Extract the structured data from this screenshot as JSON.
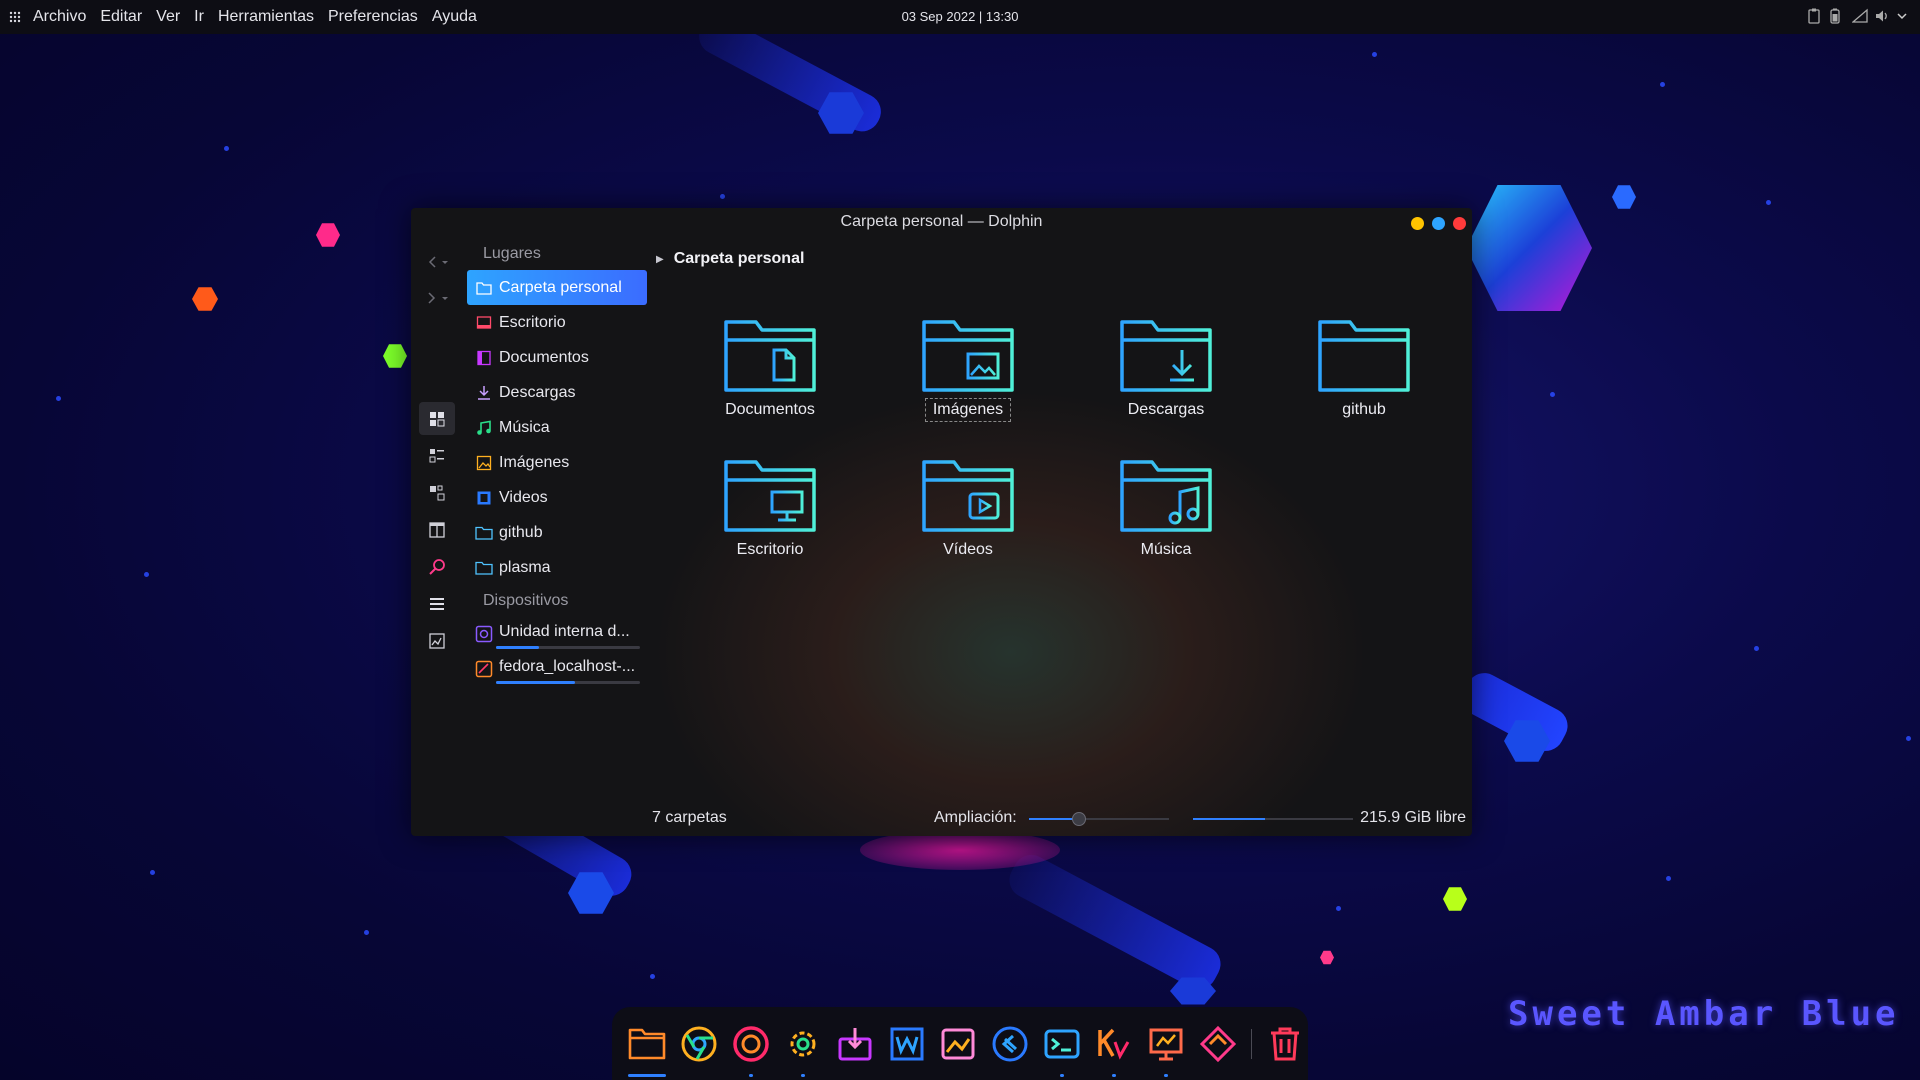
{
  "colors": {
    "accent": "#2f80ff",
    "accent_start": "#2ea4ff",
    "panel_bg": "#0d0d14",
    "window_bg": "#141416",
    "wallpaper": "#0b0a4a"
  },
  "top_panel": {
    "app_grid_icon": "app-grid-icon",
    "menus": [
      "Archivo",
      "Editar",
      "Ver",
      "Ir",
      "Herramientas",
      "Preferencias",
      "Ayuda"
    ],
    "clock": "03 Sep 2022 | 13:30",
    "tray_icons": [
      "clipboard-icon",
      "battery-icon",
      "network-icon",
      "volume-icon",
      "chevron-down-icon"
    ]
  },
  "window": {
    "title": "Carpeta personal — Dolphin",
    "buttons": [
      "minimize-button",
      "maximize-button",
      "close-button"
    ],
    "places": {
      "title": "Lugares",
      "items": [
        {
          "label": "Carpeta personal",
          "icon": "home-icon",
          "selected": true
        },
        {
          "label": "Escritorio",
          "icon": "desktop-icon"
        },
        {
          "label": "Documentos",
          "icon": "document-icon"
        },
        {
          "label": "Descargas",
          "icon": "download-icon"
        },
        {
          "label": "Música",
          "icon": "music-icon"
        },
        {
          "label": "Imágenes",
          "icon": "image-icon"
        },
        {
          "label": "Videos",
          "icon": "video-icon"
        },
        {
          "label": "github",
          "icon": "folder-icon"
        },
        {
          "label": "plasma",
          "icon": "folder-icon"
        }
      ]
    },
    "devices": {
      "title": "Dispositivos",
      "items": [
        {
          "label": "Unidad interna d...",
          "icon": "drive-icon",
          "used_fraction": 0.3
        },
        {
          "label": "fedora_localhost-...",
          "icon": "partition-icon",
          "used_fraction": 0.55
        }
      ]
    },
    "view_buttons": [
      "icons-view-icon",
      "details-view-icon",
      "compact-view-icon",
      "split-view-icon",
      "search-icon",
      "menu-icon",
      "preview-icon"
    ],
    "breadcrumb": "Carpeta personal",
    "files": [
      {
        "label": "Documentos",
        "icon": "document-folder-icon"
      },
      {
        "label": "Imágenes",
        "icon": "image-folder-icon",
        "focused": true
      },
      {
        "label": "Descargas",
        "icon": "download-folder-icon"
      },
      {
        "label": "github",
        "icon": "folder-icon"
      },
      {
        "label": "Escritorio",
        "icon": "desktop-folder-icon"
      },
      {
        "label": "Vídeos",
        "icon": "video-folder-icon"
      },
      {
        "label": "Música",
        "icon": "music-folder-icon"
      }
    ],
    "status": {
      "count": "7 carpetas",
      "zoom_label": "Ampliación:",
      "zoom_fraction": 0.36,
      "space_used_fraction": 0.45,
      "free_space": "215.9 GiB libre"
    }
  },
  "dock": {
    "items": [
      {
        "name": "files",
        "icon": "folder-icon",
        "running": true,
        "active": true
      },
      {
        "name": "chrome",
        "icon": "chrome-icon"
      },
      {
        "name": "firefox",
        "icon": "firefox-icon",
        "running": true
      },
      {
        "name": "settings",
        "icon": "gear-icon",
        "running": true
      },
      {
        "name": "software",
        "icon": "package-icon"
      },
      {
        "name": "writer",
        "icon": "writer-icon"
      },
      {
        "name": "image-viewer",
        "icon": "image-viewer-icon"
      },
      {
        "name": "vscode",
        "icon": "vscode-icon"
      },
      {
        "name": "terminal",
        "icon": "terminal-icon",
        "running": true
      },
      {
        "name": "kvantum",
        "icon": "kvantum-icon",
        "running": true
      },
      {
        "name": "presentation",
        "icon": "presentation-icon",
        "running": true
      },
      {
        "name": "inkscape",
        "icon": "inkscape-icon"
      },
      {
        "name": "trash",
        "icon": "trash-icon"
      }
    ]
  },
  "wallpaper_text": "Sweet Ambar Blue"
}
